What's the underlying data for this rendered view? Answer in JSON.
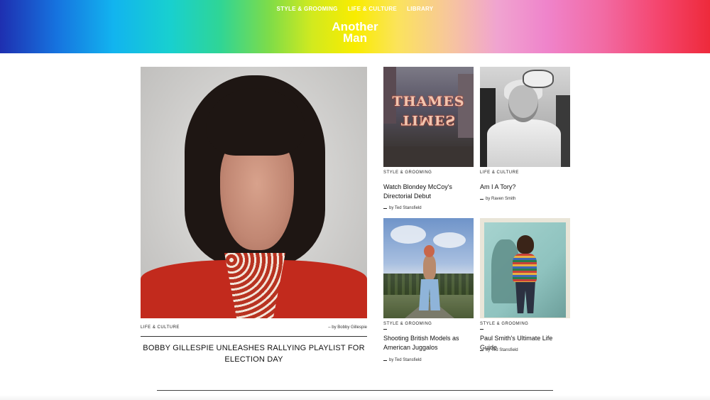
{
  "nav": {
    "items": [
      "STYLE & GROOMING",
      "LIFE & CULTURE",
      "LIBRARY"
    ]
  },
  "logo": {
    "line1": "Another",
    "line2": "Man"
  },
  "featured": {
    "category": "LIFE & CULTURE",
    "byline": "–  by Bobby Gillespie",
    "title": "BOBBY GILLESPIE UNLEASHES RALLYING PLAYLIST FOR ELECTION DAY"
  },
  "articles": [
    {
      "category": "STYLE & GROOMING",
      "title": "Watch Blondey McCoy's Directorial Debut",
      "byline": "by Ted Stansfield",
      "image_text": "THAMES"
    },
    {
      "category": "LIFE & CULTURE",
      "title": "Am I A Tory?",
      "byline": "by Raven Smith"
    },
    {
      "category": "STYLE & GROOMING",
      "title": "Shooting British Models as American Juggalos",
      "byline": "by Ted Stansfield"
    },
    {
      "category": "STYLE & GROOMING",
      "title": "Paul Smith's Ultimate Life Guide",
      "byline": "by Ted Stansfield"
    }
  ],
  "colors": {
    "header_gradient": [
      "#1e2fb0",
      "#12b4ef",
      "#7fdc48",
      "#f9ec00",
      "#f0a4d0",
      "#ee2a3b"
    ],
    "text": "#111111",
    "background": "#ffffff"
  }
}
